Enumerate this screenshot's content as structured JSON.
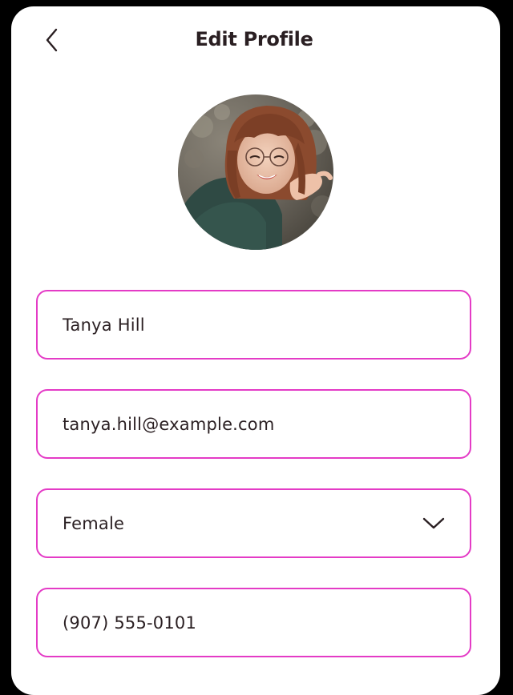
{
  "header": {
    "title": "Edit Profile",
    "back_icon": "chevron-left-icon"
  },
  "avatar": {
    "description_icon": "profile-photo"
  },
  "form": {
    "name": "Tanya Hill",
    "email": "tanya.hill@example.com",
    "gender": "Female",
    "gender_icon": "chevron-down-icon",
    "phone": "(907) 555-0101"
  },
  "colors": {
    "accent": "#e43bc6",
    "text": "#2a1f22",
    "background": "#ffffff",
    "frame": "#000000"
  }
}
